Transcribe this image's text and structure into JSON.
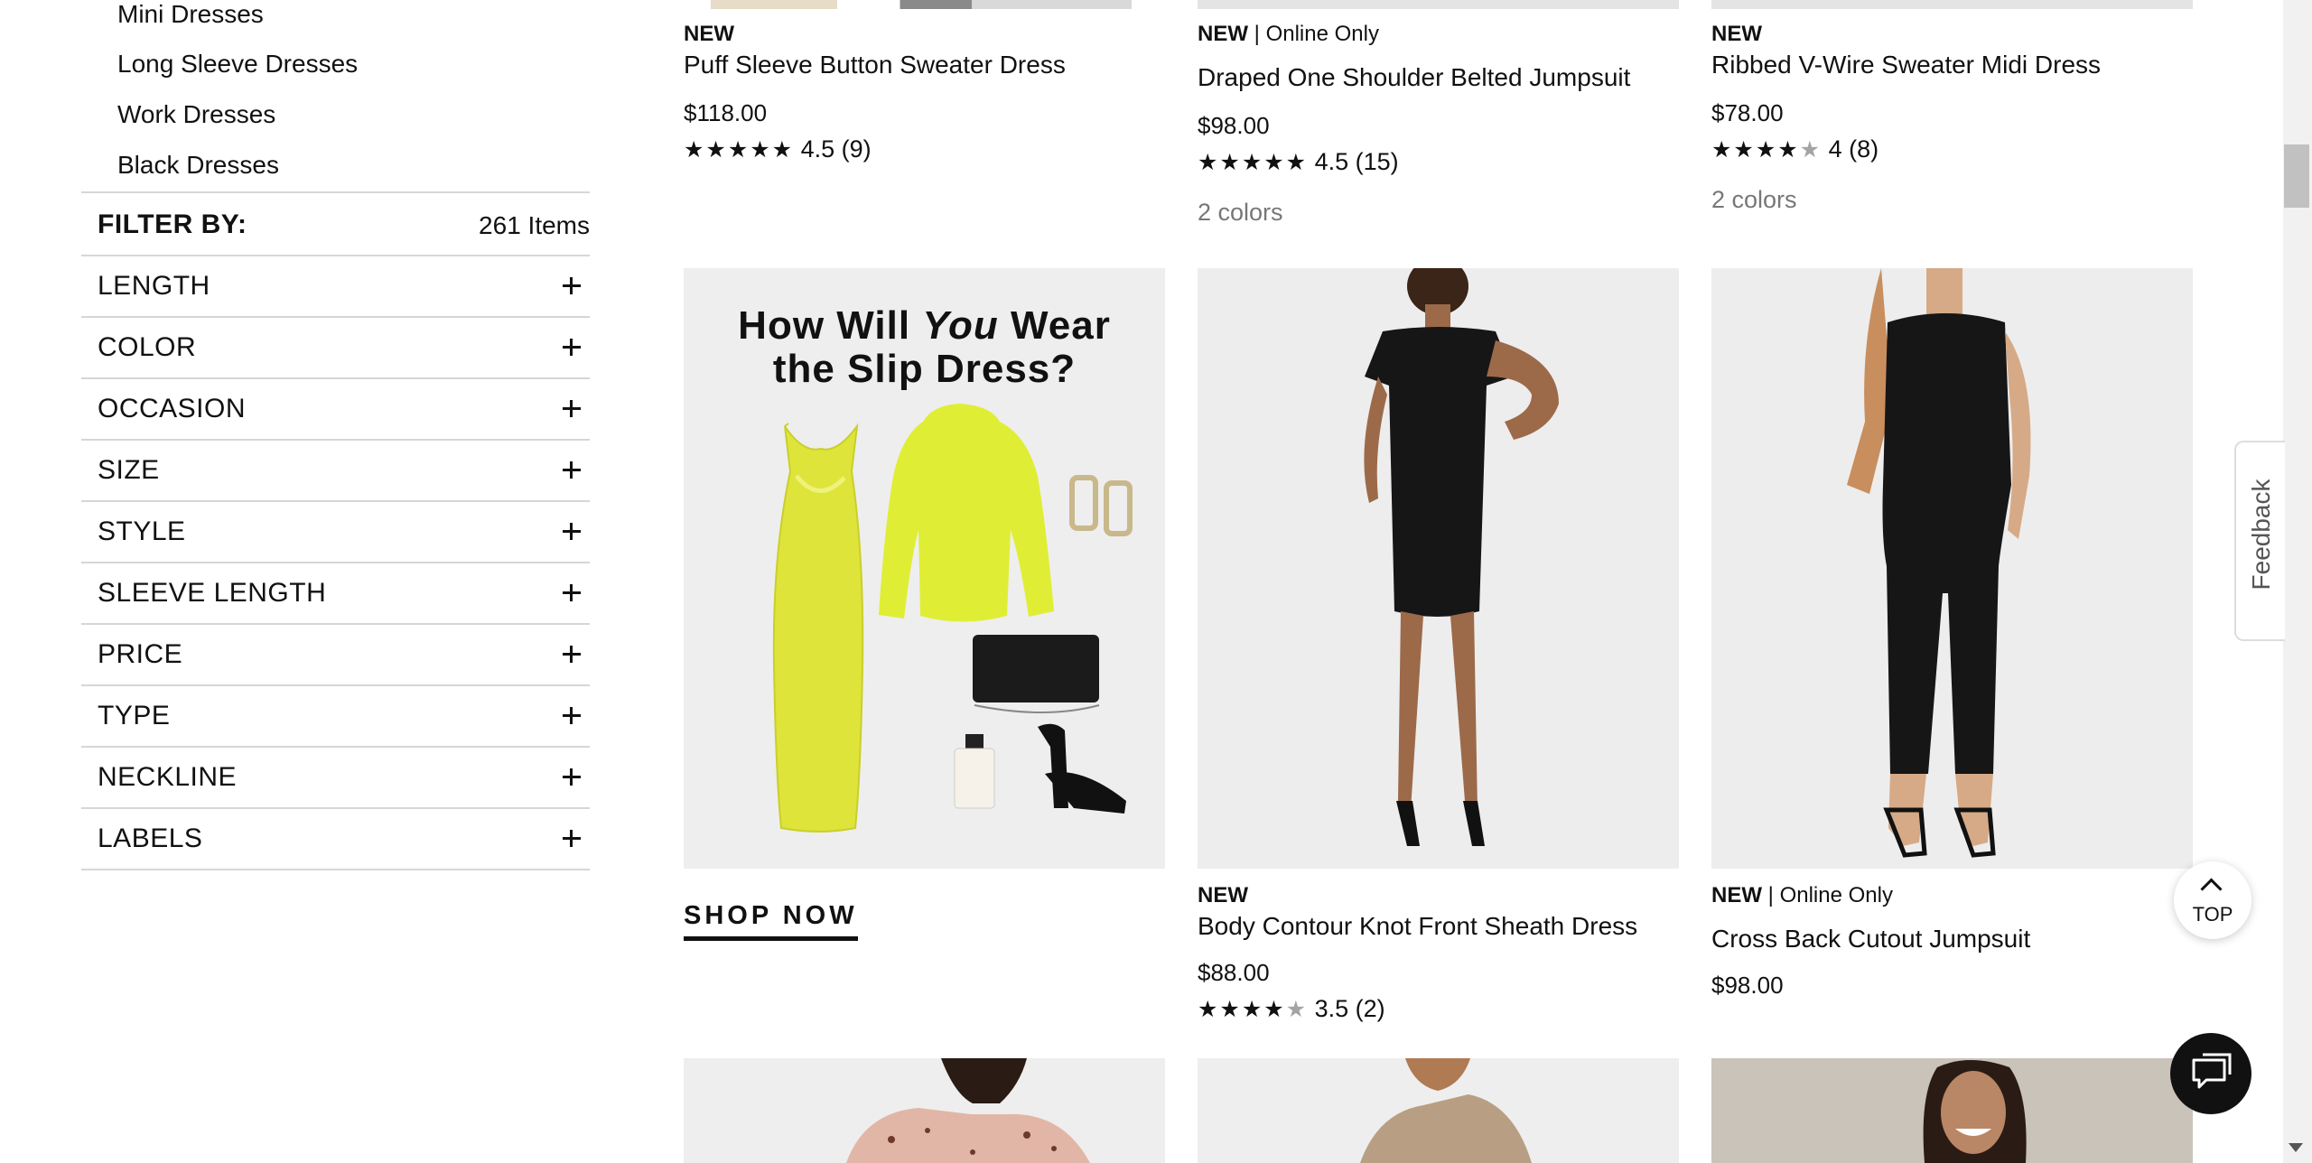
{
  "sidebar": {
    "categories": [
      "Mini Dresses",
      "Long Sleeve Dresses",
      "Work Dresses",
      "Black Dresses"
    ],
    "filter_label": "FILTER BY:",
    "item_count": "261 Items",
    "facets": [
      "LENGTH",
      "COLOR",
      "OCCASION",
      "SIZE",
      "STYLE",
      "SLEEVE LENGTH",
      "PRICE",
      "TYPE",
      "NECKLINE",
      "LABELS"
    ]
  },
  "products_row1": [
    {
      "badge": "NEW",
      "badge_extra": "",
      "title": "Puff Sleeve Button Sweater Dress",
      "price": "$118.00",
      "stars_on": "★★★★★",
      "stars_off": "",
      "rating": "4.5 (9)",
      "colors": ""
    },
    {
      "badge": "NEW",
      "badge_extra": " | Online Only",
      "title": "Draped One Shoulder Belted Jumpsuit",
      "price": "$98.00",
      "stars_on": "★★★★★",
      "stars_off": "",
      "rating": "4.5 (15)",
      "colors": "2 colors"
    },
    {
      "badge": "NEW",
      "badge_extra": "",
      "title": "Ribbed V-Wire Sweater Midi Dress",
      "price": "$78.00",
      "stars_on": "★★★★",
      "stars_off": "★",
      "rating": "4 (8)",
      "colors": "2 colors"
    }
  ],
  "promo": {
    "line1_a": "How Will ",
    "line1_b": "You",
    "line1_c": " Wear",
    "line2": "the Slip Dress?",
    "cta": "SHOP NOW"
  },
  "products_row2": [
    {
      "badge": "NEW",
      "badge_extra": "",
      "title": "Body Contour Knot Front Sheath Dress",
      "price": "$88.00",
      "stars_on": "★★★★",
      "stars_off": "★",
      "rating": "3.5 (2)"
    },
    {
      "badge": "NEW",
      "badge_extra": " | Online Only",
      "title": "Cross Back Cutout Jumpsuit",
      "price": "$98.00",
      "stars_on": "",
      "stars_off": "",
      "rating": ""
    }
  ],
  "ui": {
    "feedback": "Feedback",
    "top": "TOP"
  },
  "colors": {
    "accent_yellow": "#dfe43a",
    "dress_black": "#161616",
    "divider": "#d6d6d6"
  }
}
